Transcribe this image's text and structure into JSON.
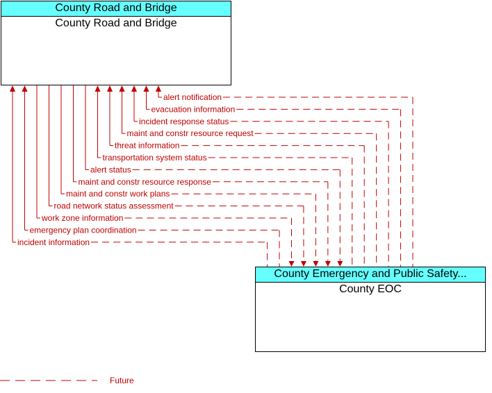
{
  "top_box": {
    "header": "County Road and Bridge",
    "name": "County Road and Bridge"
  },
  "bottom_box": {
    "header": "County Emergency and Public Safety...",
    "name": "County EOC"
  },
  "flow_color": "#c00000",
  "header_color": "#66ffff",
  "flows": [
    {
      "label": "alert notification",
      "to": "top"
    },
    {
      "label": "evacuation information",
      "to": "top"
    },
    {
      "label": "incident response status",
      "to": "top"
    },
    {
      "label": "maint and constr resource request",
      "to": "top"
    },
    {
      "label": "threat information",
      "to": "top"
    },
    {
      "label": "transportation system status",
      "to": "top"
    },
    {
      "label": "alert status",
      "to": "bottom"
    },
    {
      "label": "maint and constr resource response",
      "to": "bottom"
    },
    {
      "label": "maint and constr work plans",
      "to": "bottom"
    },
    {
      "label": "road network status assessment",
      "to": "bottom"
    },
    {
      "label": "work zone information",
      "to": "bottom"
    },
    {
      "label": "emergency plan coordination",
      "to": "top"
    },
    {
      "label": "incident information",
      "to": "top"
    }
  ],
  "legend": {
    "label": "Future",
    "style": "dashed"
  }
}
